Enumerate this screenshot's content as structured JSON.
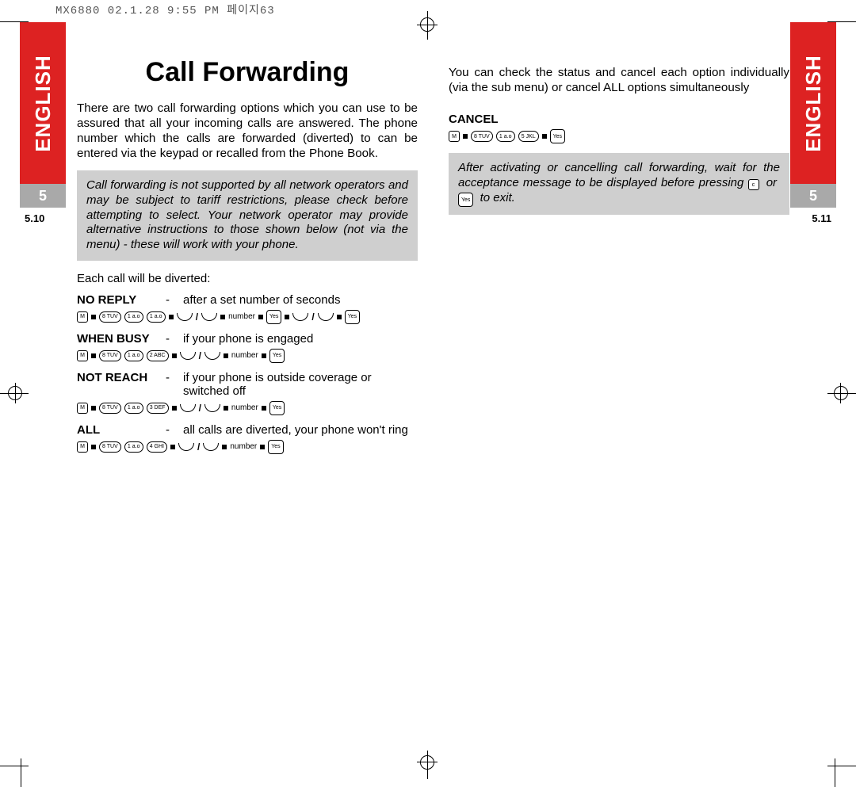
{
  "headerstamp": "MX6880 02.1.28 9:55 PM   페이지63",
  "sidebars": {
    "language": "ENGLISH",
    "section": "5",
    "left_pagenum": "5.10",
    "right_pagenum": "5.11"
  },
  "left": {
    "title": "Call Forwarding",
    "intro": "There are two call forwarding options which you can use to be assured that all your incoming calls are answered. The phone number which the calls are forwarded (diverted) to can be entered via the keypad or recalled from the Phone Book.",
    "note": "Call forwarding is not supported by all network operators and may be subject to tariff restrictions, please check before attempting to select. Your network operator may provide alternative instructions to those shown below (not via the menu) - these will work with your phone.",
    "lead": "Each call will be diverted:",
    "options": [
      {
        "name": "NO REPLY",
        "desc": "after a set number of seconds"
      },
      {
        "name": "WHEN BUSY",
        "desc": "if your phone is engaged"
      },
      {
        "name": "NOT REACH",
        "desc": "if your phone is outside coverage or switched off"
      },
      {
        "name": "ALL",
        "desc": "all calls are diverted, your phone won't ring"
      }
    ],
    "keyseq": {
      "no_reply_num": "1 a.o",
      "when_busy_num": "2 ABC",
      "not_reach_num": "3 DEF",
      "all_num": "4 GHI",
      "number_label": "number",
      "yes": "Yes",
      "menu": "M",
      "eight": "8 TUV",
      "one": "1 a.o"
    }
  },
  "right": {
    "status_para": "You can check the status and cancel each option individually (via the sub menu) or cancel ALL options simultaneously",
    "cancel_heading": "Cancel",
    "keyseq": {
      "five": "5 JKL"
    },
    "note_1": "After activating or cancelling call forwarding, wait for the acceptance message to be displayed before pressing",
    "note_or": "or",
    "note_toexit": "to exit.",
    "c_key": "c"
  }
}
